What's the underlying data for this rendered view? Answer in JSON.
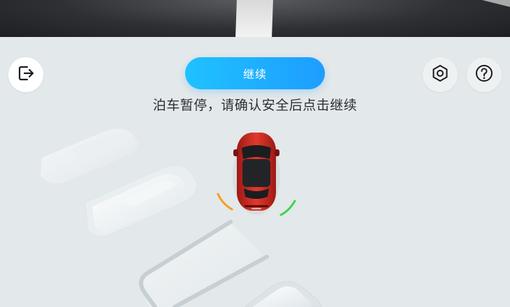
{
  "header": {
    "continue_label": "继续"
  },
  "status": {
    "message": "泊车暂停，请确认安全后点击继续"
  },
  "icons": {
    "exit": "exit-icon",
    "settings": "hexagon-settings-icon",
    "help": "help-icon"
  },
  "colors": {
    "accent": "#1e9dff",
    "car": "#c9261f",
    "sensor_warning": "#f5a11c",
    "sensor_ok": "#3ed44a"
  }
}
